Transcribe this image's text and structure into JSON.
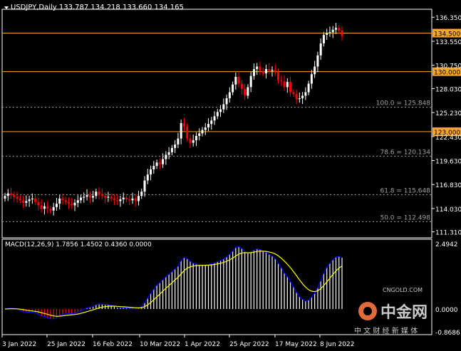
{
  "colors": {
    "background": "#000000",
    "frame": "#ffffff",
    "bull": "#ffffff",
    "bear": "#ff0000",
    "level": "#f5a623",
    "fib": "#a0a0a0",
    "macd_signal": "#0000ff",
    "macd_line": "#ffff00",
    "hist_pos": "#ffffff",
    "hist_neg": "#ff0000",
    "watermark": "#c8c8c8"
  },
  "header": {
    "symbol_line": "USDJPY,Daily  133.787 134.218 133.660 134.165"
  },
  "price_axis": {
    "ticks": [
      "136.350",
      "133.550",
      "130.750",
      "128.030",
      "125.230",
      "122.430",
      "119.630",
      "116.830",
      "114.030",
      "111.310"
    ],
    "tick_values": [
      136.35,
      133.55,
      130.75,
      128.03,
      125.23,
      122.43,
      119.63,
      116.83,
      114.03,
      111.31
    ],
    "range": [
      110.7,
      137.2
    ]
  },
  "levels": [
    {
      "value": 134.5,
      "label": "134.500"
    },
    {
      "value": 130.0,
      "label": "130.000"
    },
    {
      "value": 123.0,
      "label": "123.000"
    }
  ],
  "fib_levels": [
    {
      "value": 125.848,
      "label": "100.0 = 125.848"
    },
    {
      "value": 120.134,
      "label": "78.6 = 120.134"
    },
    {
      "value": 115.648,
      "label": "61.8 = 115.648"
    },
    {
      "value": 112.498,
      "label": "50.0 = 112.498"
    }
  ],
  "macd": {
    "label": "MACD(12,26,9) 1.7856 1.4502 0.4360 0.0000",
    "ticks": [
      "2.4942",
      "0.0000",
      "-0.8686"
    ],
    "tick_values": [
      2.4942,
      0.0,
      -0.8686
    ],
    "range": [
      -0.95,
      2.55
    ]
  },
  "date_axis": {
    "labels": [
      "3 Jan 2022",
      "25 Jan 2022",
      "16 Feb 2022",
      "10 Mar 2022",
      "1 Apr 2022",
      "25 Apr 2022",
      "17 May 2022",
      "8 Jun 2022"
    ]
  },
  "watermark": {
    "brand": "中金网",
    "site": "CNGOLD.COM",
    "tagline": "中 文 财 经 新 媒 体"
  },
  "chart_data": {
    "type": "candlestick",
    "symbol": "USDJPY",
    "timeframe": "Daily",
    "x_range": [
      "3 Jan 2022",
      "13 Jun 2022"
    ],
    "series": [
      {
        "name": "close",
        "values": [
          115.5,
          115.8,
          115.6,
          115.4,
          115.2,
          115.0,
          114.7,
          114.9,
          115.1,
          115.2,
          114.8,
          114.4,
          114.0,
          114.3,
          114.0,
          113.8,
          114.2,
          114.6,
          115.2,
          115.0,
          114.8,
          114.6,
          114.4,
          114.7,
          115.0,
          115.3,
          115.4,
          115.6,
          115.3,
          115.5,
          116.0,
          115.7,
          115.5,
          115.3,
          115.4,
          115.2,
          115.0,
          114.9,
          115.1,
          115.3,
          115.1,
          115.0,
          115.2,
          114.9,
          115.5,
          116.0,
          117.3,
          118.0,
          118.6,
          119.0,
          119.4,
          119.2,
          119.8,
          120.3,
          120.6,
          121.1,
          121.5,
          122.2,
          124.0,
          123.6,
          122.2,
          121.7,
          122.0,
          122.5,
          122.8,
          123.2,
          123.5,
          123.9,
          124.3,
          124.8,
          125.3,
          125.6,
          126.2,
          126.9,
          127.6,
          128.5,
          129.4,
          128.6,
          128.0,
          127.2,
          128.2,
          129.5,
          130.3,
          130.6,
          130.1,
          129.8,
          130.3,
          130.1,
          130.2,
          130.0,
          129.0,
          128.9,
          128.2,
          128.8,
          127.6,
          127.4,
          126.8,
          126.9,
          127.2,
          127.6,
          128.6,
          129.7,
          130.6,
          131.9,
          133.3,
          134.3,
          134.5,
          134.6,
          134.9,
          135.1,
          134.8,
          134.17
        ]
      }
    ]
  }
}
